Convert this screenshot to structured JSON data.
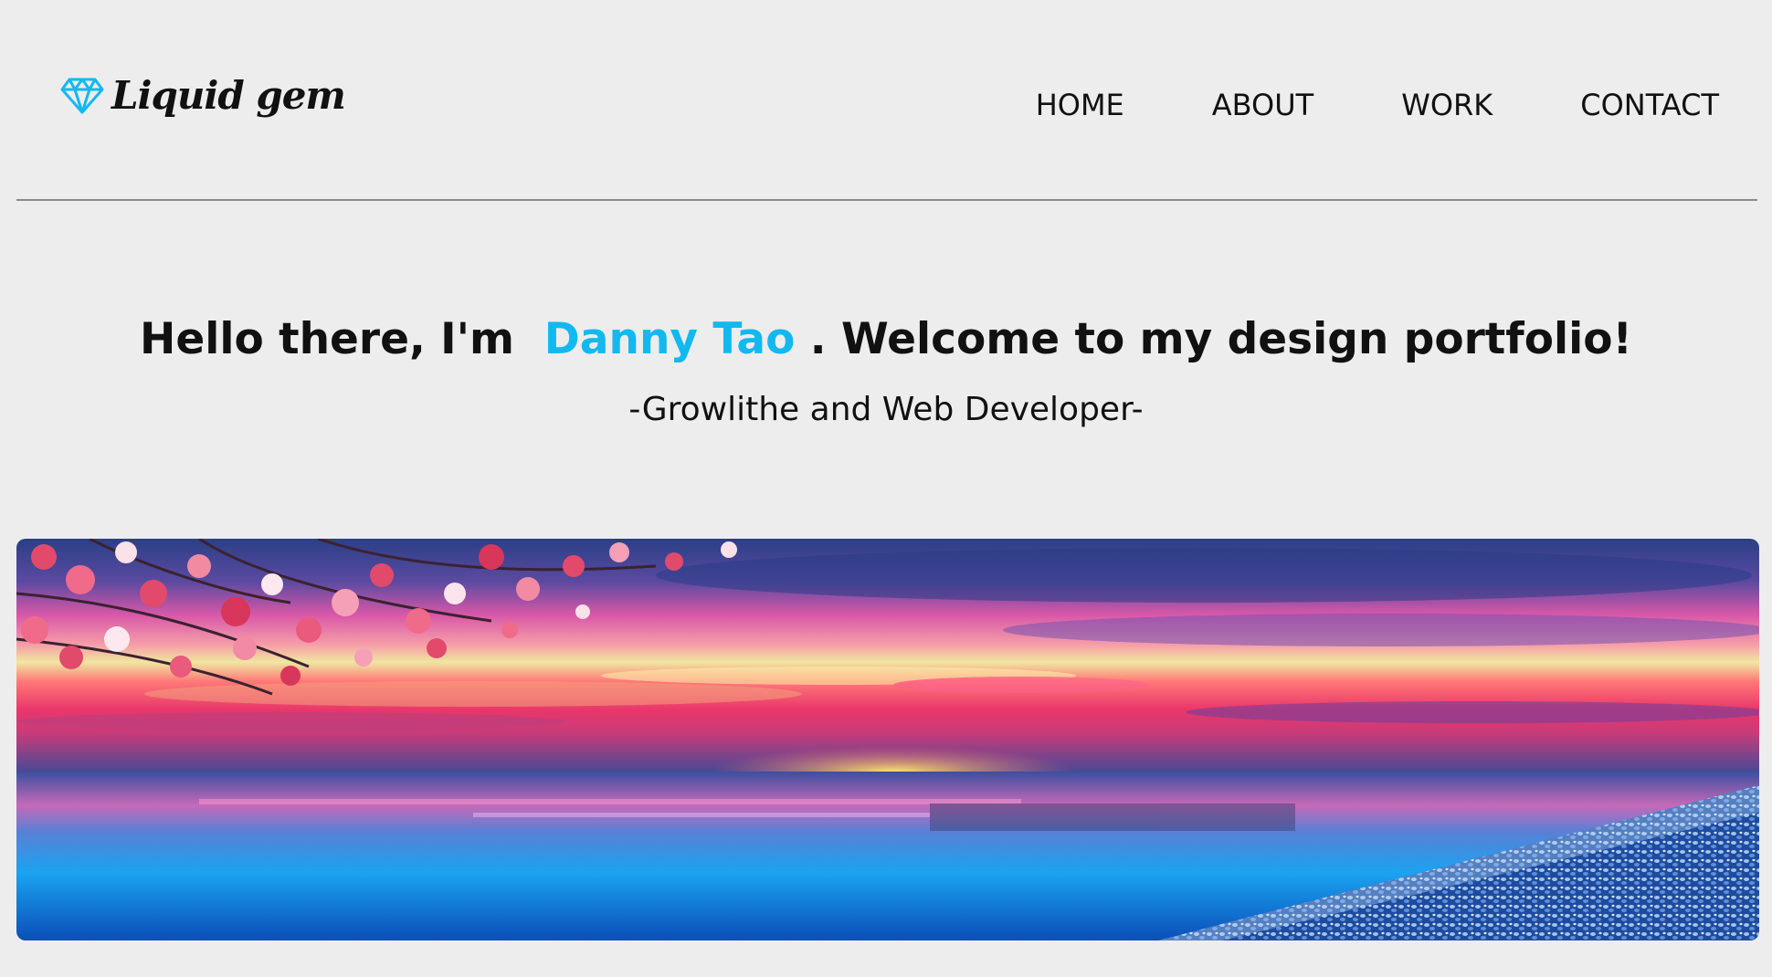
{
  "brand": {
    "name": "Liquid gem",
    "icon": "diamond-icon",
    "accent_color": "#13b8ef"
  },
  "nav": {
    "items": [
      {
        "label": "HOME"
      },
      {
        "label": "ABOUT"
      },
      {
        "label": "WORK"
      },
      {
        "label": "CONTACT"
      }
    ]
  },
  "hero": {
    "greeting_prefix": "Hello there, I'm",
    "name": "Danny Tao",
    "greeting_suffix": ". Welcome to my design portfolio!",
    "subtitle": "-Growlithe and Web Developer-"
  },
  "banner": {
    "image": "sunset-beach-cherry-blossom-image"
  }
}
